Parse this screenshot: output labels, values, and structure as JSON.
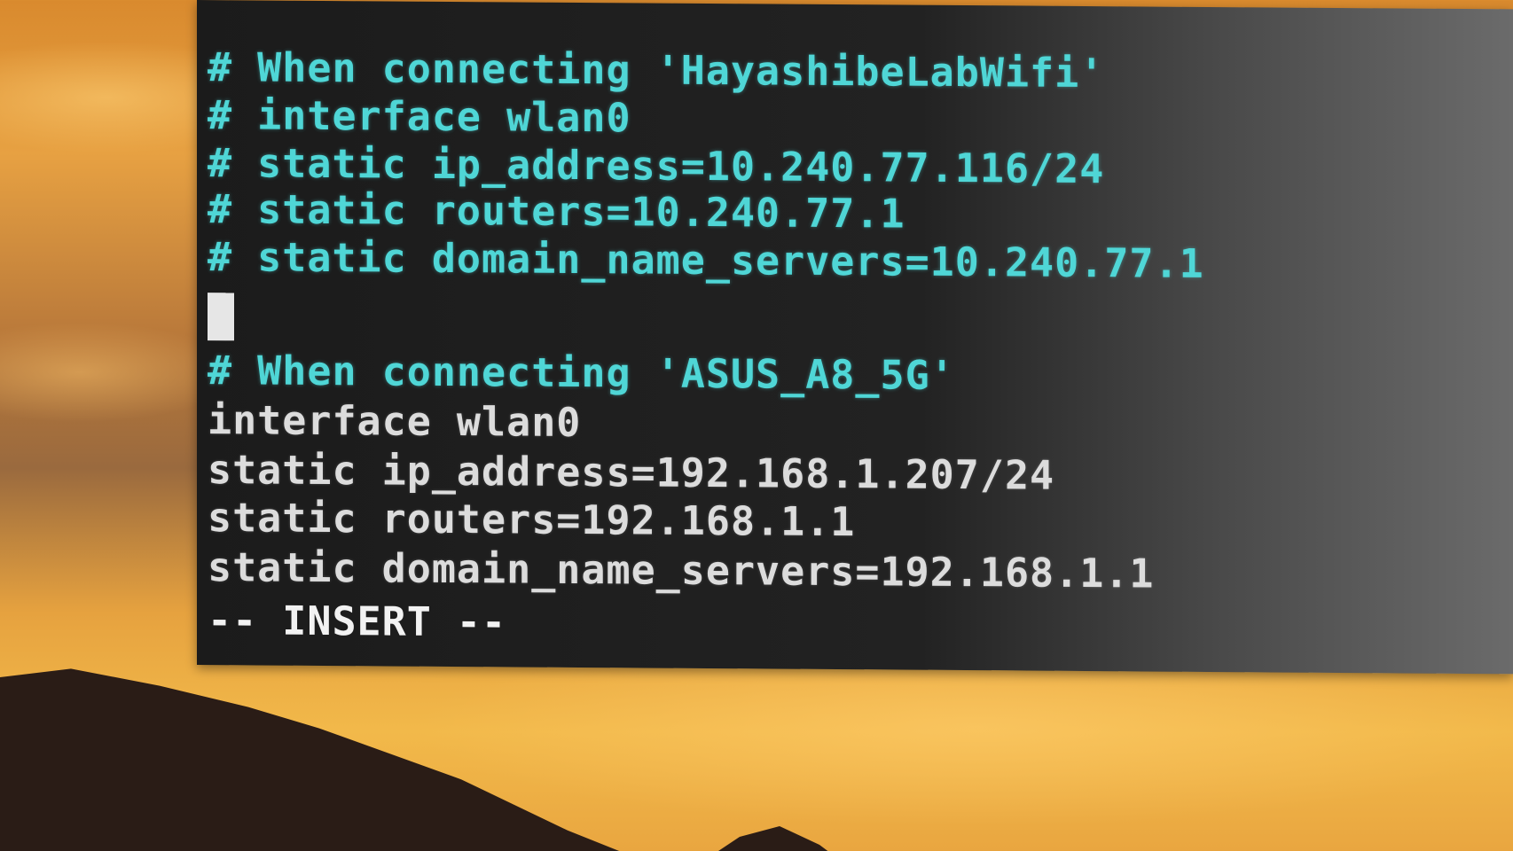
{
  "editor": {
    "lines": [
      "# When connecting 'HayashibeLabWifi'",
      "# interface wlan0",
      "# static ip_address=10.240.77.116/24",
      "# static routers=10.240.77.1",
      "# static domain_name_servers=10.240.77.1",
      "",
      "# When connecting 'ASUS_A8_5G'",
      "interface wlan0",
      "static ip_address=192.168.1.207/24",
      "static routers=192.168.1.1",
      "static domain_name_servers=192.168.1.1"
    ],
    "mode_indicator": "-- INSERT --"
  },
  "colors": {
    "comment": "#4fd6d6",
    "text": "#dcdcdc",
    "background": "#1b1b1b"
  }
}
